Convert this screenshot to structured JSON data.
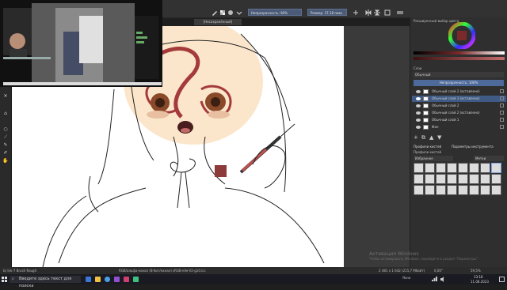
{
  "toolbar": {
    "opacity_label": "Непрозрачность: 90%",
    "size_label": "Размер: 37,18 пикс."
  },
  "document_tab": {
    "title": "[Несохранённый]"
  },
  "right_docker": {
    "color_selector_title": "Расширенный выбор цвета",
    "layers_title": "Слои",
    "blend_mode": "Обычный",
    "layer_opacity": "Непрозрачность: 100%",
    "layers": [
      {
        "name": "Обычный слой 2 (вставлено)"
      },
      {
        "name": "Обычный слой 3 (вставлено)"
      },
      {
        "name": "Обычный слой 2"
      },
      {
        "name": "Обычный слой 2 (вставлено)"
      },
      {
        "name": "Обычный слой 1"
      },
      {
        "name": "Фон"
      }
    ],
    "brush_tabs": [
      "Профили кистей",
      "Параметры инструмента"
    ],
    "brush_presets_title": "Профили кистей",
    "brush_tag": "Избранное",
    "brush_search": "Метки"
  },
  "statusbar": {
    "brush_name": "b) Ink-7 Brush Rough",
    "color_info": "RGB/альфа-канал (8-бит/канал) sRGB-elle-V2-g10.icc",
    "image_size": "2 481 x 1 642 (215,7 Мбайт)",
    "rotation": "0,00°",
    "zoom": "59,5%"
  },
  "watermark": {
    "line1": "Активация Windows",
    "line2": "Чтобы активировать Windows, перейдите в раздел \"Параметры\"."
  },
  "taskbar": {
    "search_placeholder": "Введите здесь текст для поиска",
    "time": "13:16",
    "date": "11.08.2023",
    "weather": "Ясно"
  },
  "colors": {
    "fg_color": "#7a2a2a",
    "accent": "#4d6a9a",
    "selected_layer": "#3f5a84"
  }
}
